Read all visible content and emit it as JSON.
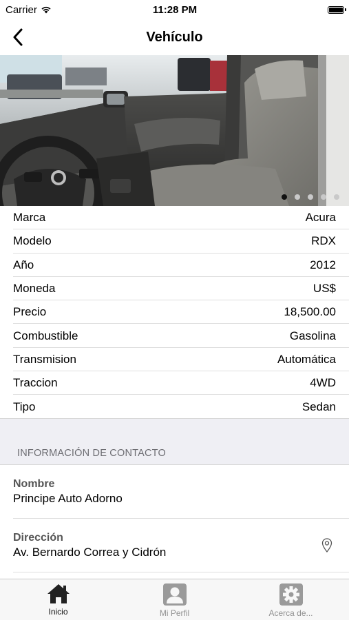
{
  "status_bar": {
    "carrier": "Carrier",
    "time": "11:28 PM"
  },
  "nav": {
    "title": "Vehículo",
    "back_icon": "chevron-left-icon"
  },
  "photo": {
    "page_count": 5,
    "current_page": 1
  },
  "specs": [
    {
      "label": "Marca",
      "value": "Acura"
    },
    {
      "label": "Modelo",
      "value": "RDX"
    },
    {
      "label": "Año",
      "value": "2012"
    },
    {
      "label": "Moneda",
      "value": "US$"
    },
    {
      "label": "Precio",
      "value": "18,500.00"
    },
    {
      "label": "Combustible",
      "value": "Gasolina"
    },
    {
      "label": "Transmision",
      "value": "Automática"
    },
    {
      "label": "Traccion",
      "value": "4WD"
    },
    {
      "label": "Tipo",
      "value": "Sedan"
    }
  ],
  "contact": {
    "header": "INFORMACIÓN DE CONTACTO",
    "name_label": "Nombre",
    "name_value": "Principe Auto Adorno",
    "address_label": "Dirección",
    "address_value": "Av. Bernardo Correa y Cidrón"
  },
  "tabs": [
    {
      "label": "Inicio",
      "icon": "home-icon",
      "active": true
    },
    {
      "label": "Mi Perfil",
      "icon": "profile-icon",
      "active": false
    },
    {
      "label": "Acerca de...",
      "icon": "gear-icon",
      "active": false
    }
  ],
  "colors": {
    "section_bg": "#efeff4",
    "active_dot": "#111111",
    "inactive_tab": "#929292"
  }
}
